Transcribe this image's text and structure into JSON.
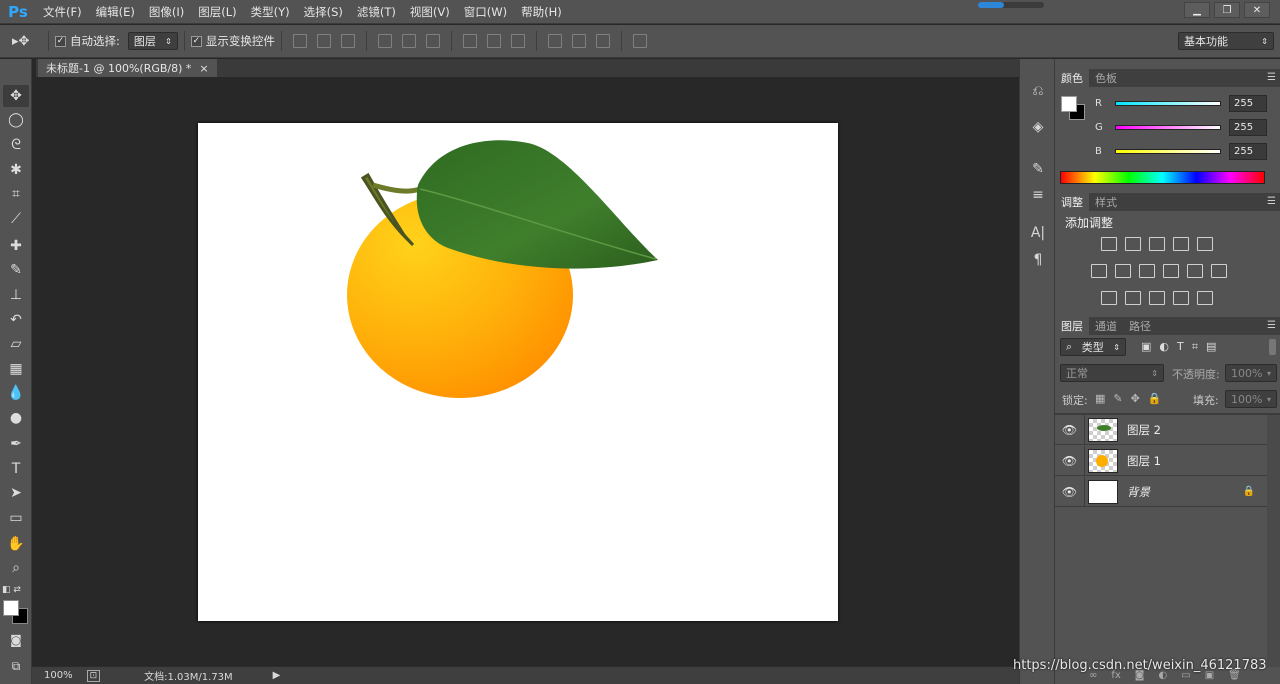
{
  "app": {
    "logo": "Ps"
  },
  "menu": [
    "文件(F)",
    "编辑(E)",
    "图像(I)",
    "图层(L)",
    "类型(Y)",
    "选择(S)",
    "滤镜(T)",
    "视图(V)",
    "窗口(W)",
    "帮助(H)"
  ],
  "options": {
    "auto_select_label": "自动选择:",
    "auto_select_value": "图层",
    "show_transform_label": "显示变换控件",
    "workspace": "基本功能"
  },
  "document": {
    "tab_title": "未标题-1 @ 100%(RGB/8) *",
    "close": "×"
  },
  "status": {
    "zoom": "100%",
    "doc_size": "文档:1.03M/1.73M"
  },
  "color_panel": {
    "tabs": [
      "颜色",
      "色板"
    ],
    "channels": [
      {
        "label": "R",
        "value": "255",
        "color": "#00e5ff"
      },
      {
        "label": "G",
        "value": "255",
        "color": "#ff00ff"
      },
      {
        "label": "B",
        "value": "255",
        "color": "#ffff00"
      }
    ]
  },
  "adjust_panel": {
    "tabs": [
      "调整",
      "样式"
    ],
    "title": "添加调整"
  },
  "layers_panel": {
    "tabs": [
      "图层",
      "通道",
      "路径"
    ],
    "filter_kind": "类型",
    "blend_mode": "正常",
    "opacity_label": "不透明度:",
    "opacity_value": "100%",
    "lock_label": "锁定:",
    "fill_label": "填充:",
    "fill_value": "100%",
    "layers": [
      {
        "name": "图层 2"
      },
      {
        "name": "图层 1"
      },
      {
        "name": "背景"
      }
    ]
  },
  "watermark": "https://blog.csdn.net/weixin_46121783"
}
